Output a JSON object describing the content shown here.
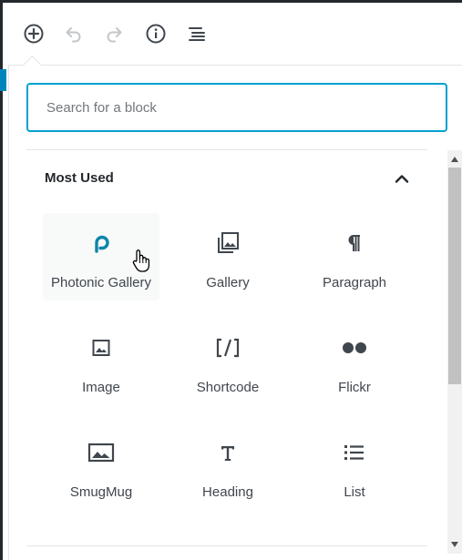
{
  "search": {
    "placeholder": "Search for a block"
  },
  "section": {
    "title": "Most Used"
  },
  "blocks": [
    {
      "label": "Photonic Gallery",
      "icon": "photonic-p-icon"
    },
    {
      "label": "Gallery",
      "icon": "gallery-icon"
    },
    {
      "label": "Paragraph",
      "icon": "paragraph-icon"
    },
    {
      "label": "Image",
      "icon": "image-icon"
    },
    {
      "label": "Shortcode",
      "icon": "shortcode-icon"
    },
    {
      "label": "Flickr",
      "icon": "flickr-icon"
    },
    {
      "label": "SmugMug",
      "icon": "smugmug-icon"
    },
    {
      "label": "Heading",
      "icon": "heading-icon"
    },
    {
      "label": "List",
      "icon": "list-icon"
    }
  ],
  "colors": {
    "accent": "#00a0d2",
    "photonic": "#0e86a8",
    "icon": "#40464d"
  }
}
